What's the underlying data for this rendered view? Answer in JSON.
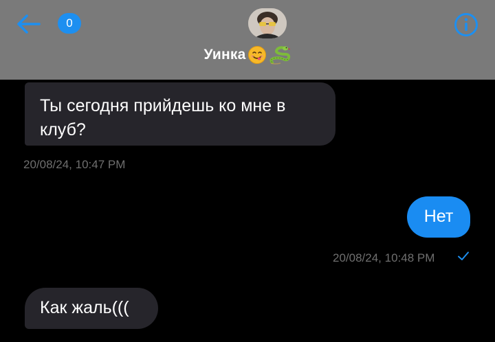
{
  "header": {
    "unread_count": "0",
    "contact_name": "Уинка",
    "back_icon": "arrow-left-icon",
    "info_icon": "info-circle-icon",
    "accent_color": "#1d8ff0"
  },
  "messages": [
    {
      "direction": "incoming",
      "text": "Ты сегодня прийдешь ко мне в клуб?",
      "timestamp": "20/08/24, 10:47 PM"
    },
    {
      "direction": "outgoing",
      "text": "Нет",
      "timestamp": "20/08/24, 10:48 PM",
      "status_icon": "checkmark-icon"
    },
    {
      "direction": "incoming",
      "text": "Как жаль((("
    }
  ]
}
